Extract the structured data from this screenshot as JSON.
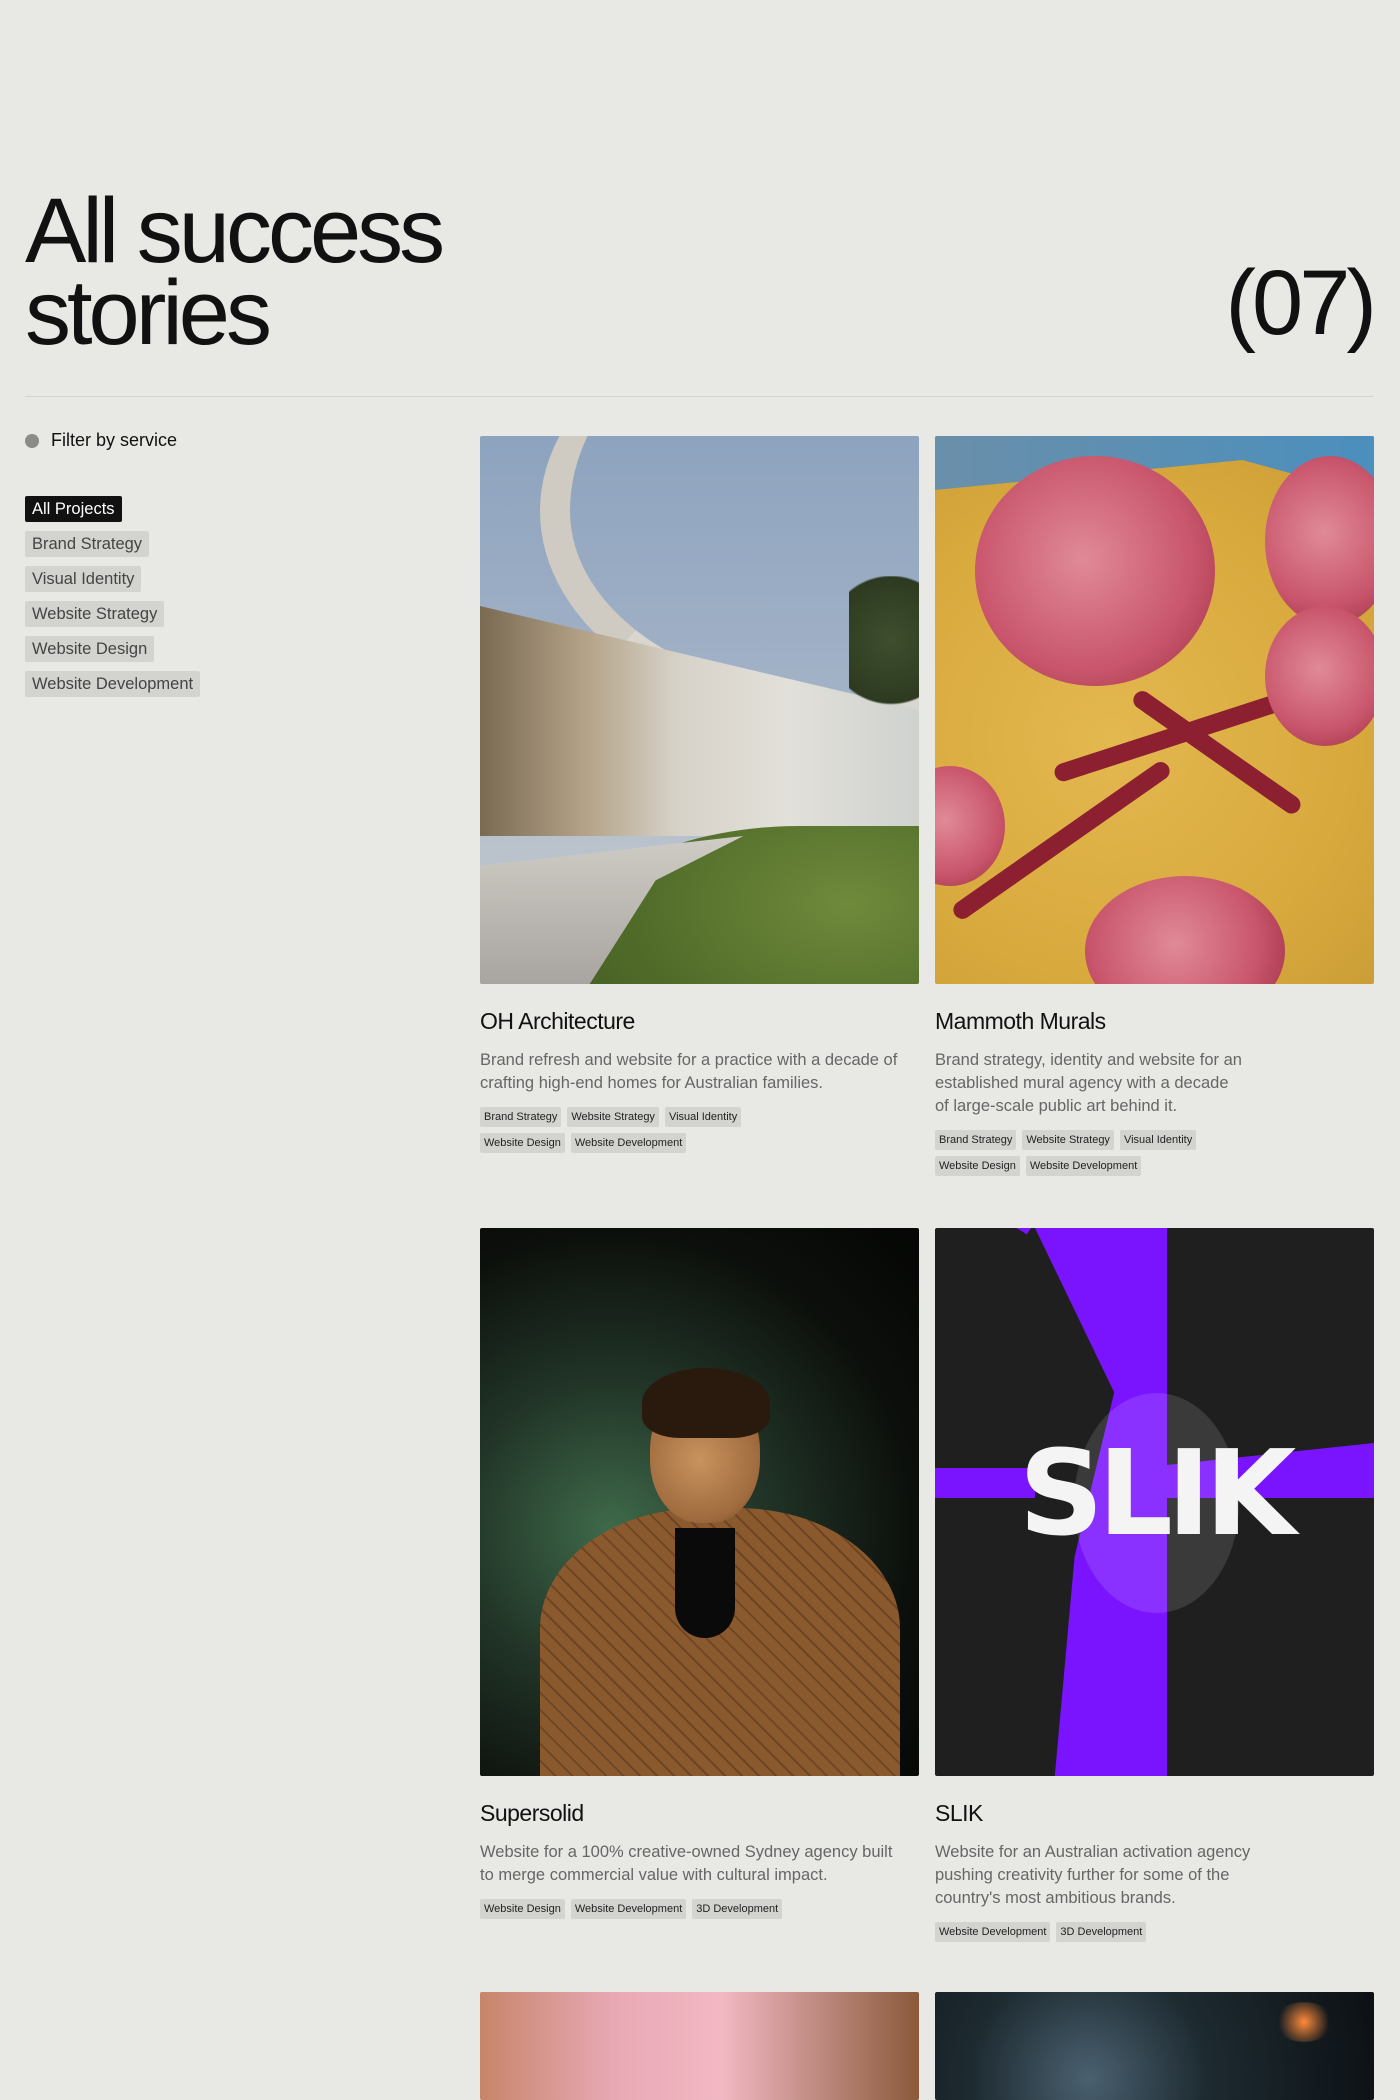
{
  "header": {
    "title_line1": "All success",
    "title_line2": "stories",
    "count": "(07)"
  },
  "filter": {
    "heading": "Filter by service",
    "options": [
      {
        "label": "All Projects",
        "active": true
      },
      {
        "label": "Brand Strategy",
        "active": false
      },
      {
        "label": "Visual Identity",
        "active": false
      },
      {
        "label": "Website Strategy",
        "active": false
      },
      {
        "label": "Website Design",
        "active": false
      },
      {
        "label": "Website Development",
        "active": false
      }
    ]
  },
  "projects": [
    {
      "title": "OH Architecture",
      "description": "Brand refresh and website for a practice with a decade of crafting high-end homes for Australian families.",
      "tags": [
        "Brand Strategy",
        "Website Strategy",
        "Visual Identity",
        "Website Design",
        "Website Development"
      ]
    },
    {
      "title": "Mammoth Murals",
      "description": "Brand strategy, identity and website for an established mural agency with a decade of large-scale public art behind it.",
      "tags": [
        "Brand Strategy",
        "Website Strategy",
        "Visual Identity",
        "Website Design",
        "Website Development"
      ]
    },
    {
      "title": "Supersolid",
      "description": "Website for a 100% creative-owned Sydney agency built to merge commercial value with cultural impact.",
      "tags": [
        "Website Design",
        "Website Development",
        "3D Development"
      ]
    },
    {
      "title": "SLIK",
      "description": "Website for an Australian activation agency pushing creativity further for some of the country's most ambitious brands.",
      "tags": [
        "Website Development",
        "3D Development"
      ],
      "image_text": "SLIK"
    }
  ],
  "colors": {
    "background": "#e8e8e4",
    "chip": "#d3d3cf",
    "chip_active": "#111111",
    "accent_purple": "#7a14ff"
  }
}
